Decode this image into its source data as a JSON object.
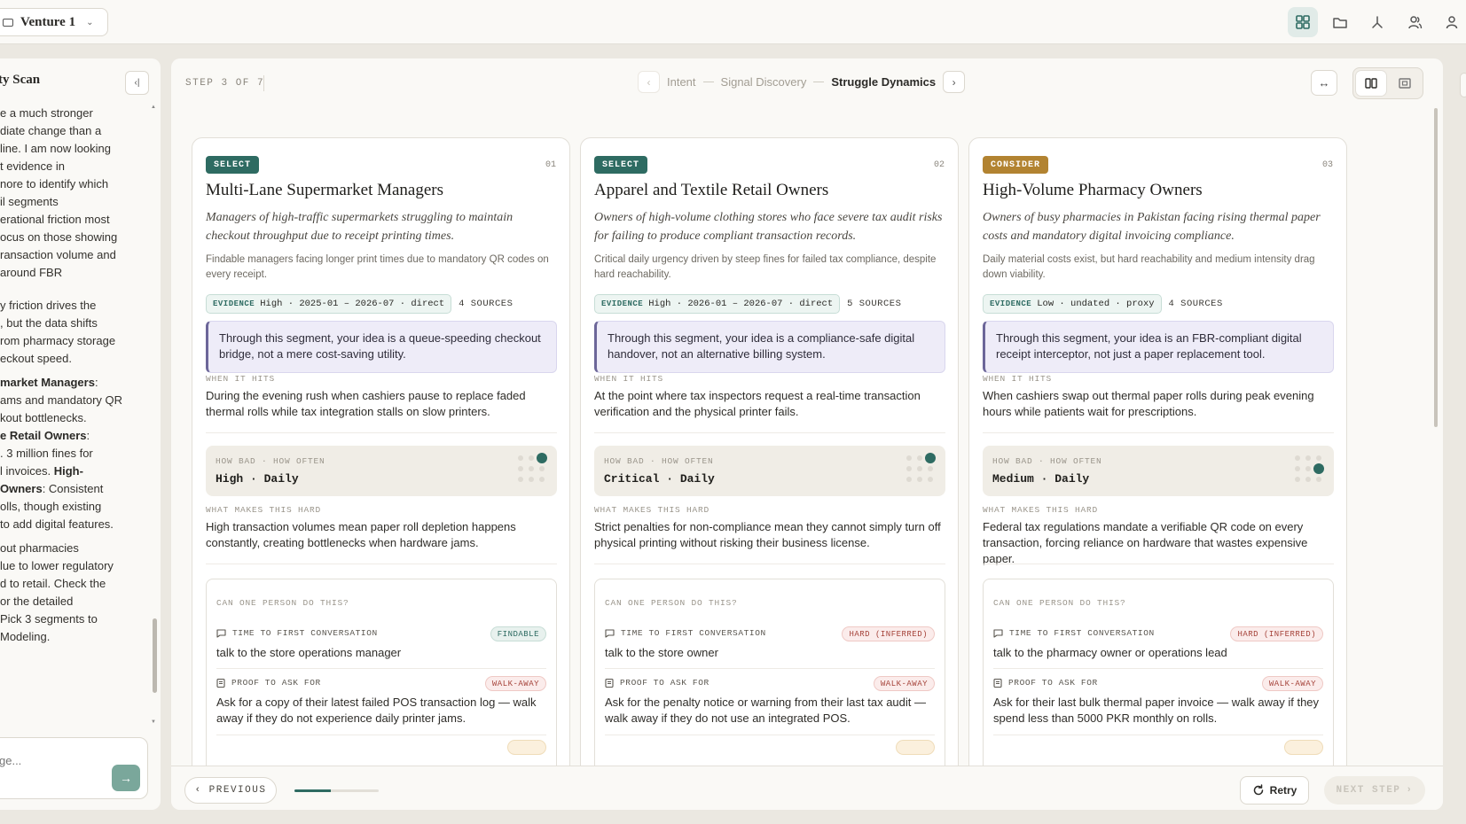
{
  "topbar": {
    "venture_name": "Venture 1",
    "icons": [
      "grid-icon",
      "folder-icon",
      "fork-icon",
      "users-icon",
      "user-icon"
    ]
  },
  "left_panel": {
    "title": "ty Scan",
    "message_lines_1": [
      "e a much stronger",
      "diate change than a",
      "line. I am now looking",
      "t evidence in",
      "nore to identify which",
      "il segments",
      "erational friction most",
      "ocus on those showing",
      "ransaction volume and",
      "around FBR"
    ],
    "message_lines_2": [
      "y friction drives the",
      ", but the data shifts",
      "rom pharmacy storage",
      "eckout speed."
    ],
    "message_lines_3": [
      {
        "bold": "market Managers",
        "rest": ":"
      },
      {
        "bold": "",
        "rest": "ams and mandatory QR"
      },
      {
        "bold": "",
        "rest": "kout bottlenecks."
      },
      {
        "bold": "e Retail Owners",
        "rest": ":"
      },
      {
        "bold": "",
        "rest": ". 3 million fines for"
      },
      {
        "bold": "",
        "rest": "l invoices. ",
        "bold2": "High-"
      },
      {
        "bold": " Owners",
        "rest": ": Consistent"
      },
      {
        "bold": "",
        "rest": "olls, though existing"
      },
      {
        "bold": "",
        "rest": "to add digital features."
      }
    ],
    "message_lines_4": [
      "out pharmacies",
      "lue to lower regulatory",
      "d to retail. Check the",
      "or the detailed",
      "Pick 3 segments to",
      " Modeling."
    ],
    "input_placeholder": "ge..."
  },
  "header": {
    "step_label": "STEP 3 OF 7",
    "steps": [
      "Intent",
      "Signal Discovery",
      "Struggle Dynamics"
    ]
  },
  "labels": {
    "evidence": "EVIDENCE",
    "when_it_hits": "WHEN IT HITS",
    "how_bad": "HOW BAD · HOW OFTEN",
    "what_makes_hard": "WHAT MAKES THIS HARD",
    "can_one_person": "CAN ONE PERSON DO THIS?",
    "time_first_conv": "TIME TO FIRST CONVERSATION",
    "proof_ask": "PROOF TO ASK FOR"
  },
  "cards": [
    {
      "badge": "SELECT",
      "number": "01",
      "title": "Multi-Lane Supermarket Managers",
      "description": "Managers of high-traffic supermarkets struggling to maintain checkout throughput due to receipt printing times.",
      "note": "Findable managers facing longer print times due to mandatory QR codes on every receipt.",
      "evidence": "High · 2025-01 – 2026-07 · direct",
      "sources": "4 SOURCES",
      "reframe": "Through this segment, your idea is a queue-speeding checkout bridge, not a mere cost-saving utility.",
      "when_it_hits": "During the evening rush when cashiers pause to replace faded thermal rolls while tax integration stalls on slow printers.",
      "how_bad": "High · Daily",
      "severity_level": 3,
      "frequency_level": 3,
      "what_makes_hard": "High transaction volumes mean paper roll depletion happens constantly, creating bottlenecks when hardware jams.",
      "conversation_pill": "FINDABLE",
      "conversation_text": "talk to the store operations manager",
      "proof_pill": "WALK-AWAY",
      "proof_text": "Ask for a copy of their latest failed POS transaction log — walk away if they do not experience daily printer jams."
    },
    {
      "badge": "SELECT",
      "number": "02",
      "title": "Apparel and Textile Retail Owners",
      "description": "Owners of high-volume clothing stores who face severe tax audit risks for failing to produce compliant transaction records.",
      "note": "Critical daily urgency driven by steep fines for failed tax compliance, despite hard reachability.",
      "evidence": "High · 2026-01 – 2026-07 · direct",
      "sources": "5 SOURCES",
      "reframe": "Through this segment, your idea is a compliance-safe digital handover, not an alternative billing system.",
      "when_it_hits": "At the point where tax inspectors request a real-time transaction verification and the physical printer fails.",
      "how_bad": "Critical · Daily",
      "severity_level": 3,
      "frequency_level": 3,
      "what_makes_hard": "Strict penalties for non-compliance mean they cannot simply turn off physical printing without risking their business license.",
      "conversation_pill": "HARD (INFERRED)",
      "conversation_text": "talk to the store owner",
      "proof_pill": "WALK-AWAY",
      "proof_text": "Ask for the penalty notice or warning from their last tax audit — walk away if they do not use an integrated POS."
    },
    {
      "badge": "CONSIDER",
      "number": "03",
      "title": "High-Volume Pharmacy Owners",
      "description": "Owners of busy pharmacies in Pakistan facing rising thermal paper costs and mandatory digital invoicing compliance.",
      "note": "Daily material costs exist, but hard reachability and medium intensity drag down viability.",
      "evidence": "Low · undated · proxy",
      "sources": "4 SOURCES",
      "reframe": "Through this segment, your idea is an FBR-compliant digital receipt interceptor, not just a paper replacement tool.",
      "when_it_hits": "When cashiers swap out thermal paper rolls during peak evening hours while patients wait for prescriptions.",
      "how_bad": "Medium · Daily",
      "severity_level": 2,
      "frequency_level": 3,
      "what_makes_hard": "Federal tax regulations mandate a verifiable QR code on every transaction, forcing reliance on hardware that wastes expensive paper.",
      "conversation_pill": "HARD (INFERRED)",
      "conversation_text": "talk to the pharmacy owner or operations lead",
      "proof_pill": "WALK-AWAY",
      "proof_text": "Ask for their last bulk thermal paper invoice — walk away if they spend less than 5000 PKR monthly on rolls."
    }
  ],
  "footer": {
    "previous_label": "PREVIOUS",
    "retry_label": "Retry",
    "next_label": "NEXT STEP",
    "progress": 0.43
  },
  "colors": {
    "accent": "#2e6b62",
    "consider": "#b28331",
    "reframe_border": "#6c6699"
  }
}
